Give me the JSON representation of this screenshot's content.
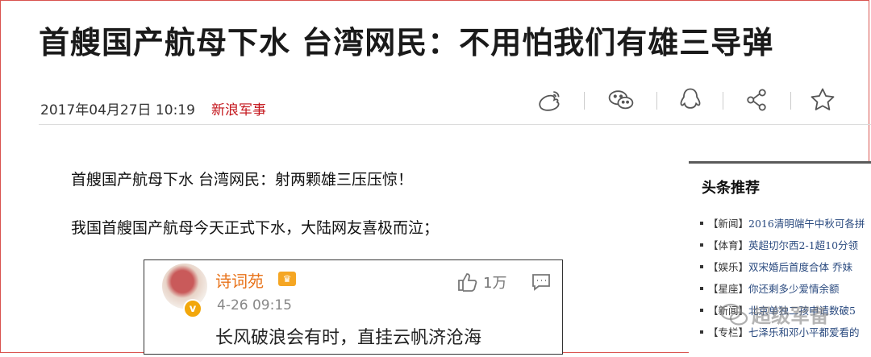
{
  "article": {
    "headline": "首艘国产航母下水 台湾网民：不用怕我们有雄三导弹",
    "date": "2017年04月27日 10:19",
    "source": "新浪军事",
    "paragraphs": [
      "首艘国产航母下水 台湾网民：射两颗雄三压压惊！",
      "我国首艘国产航母今天正式下水，大陆网友喜极而泣；"
    ]
  },
  "share_icons": [
    "weibo-icon",
    "wechat-icon",
    "qq-icon",
    "share-icon",
    "star-icon"
  ],
  "weibo_post": {
    "username": "诗词苑",
    "timestamp": "4-26 09:15",
    "likes": "1万",
    "text": "长风破浪会有时，直挂云帆济沧海"
  },
  "sidebar": {
    "title": "头条推荐",
    "items": [
      {
        "tag": "【新闻】",
        "text": "2016清明端午中秋可各拼"
      },
      {
        "tag": "【体育】",
        "text": "英超切尔西2-1超10分领"
      },
      {
        "tag": "【娱乐】",
        "text": "双宋婚后首度合体 乔妹"
      },
      {
        "tag": "【星座】",
        "text": "你还剩多少爱情余额 "
      },
      {
        "tag": "【新闻】",
        "text": "北京单独二孩申请数破5"
      },
      {
        "tag": "【专栏】",
        "text": "七泽乐和邓小平都爱看的"
      }
    ]
  },
  "watermark": {
    "text": "超级军备"
  },
  "colors": {
    "source_red": "#c4161c",
    "weibo_orange": "#e8731a",
    "link_blue": "#2a4a7f"
  }
}
